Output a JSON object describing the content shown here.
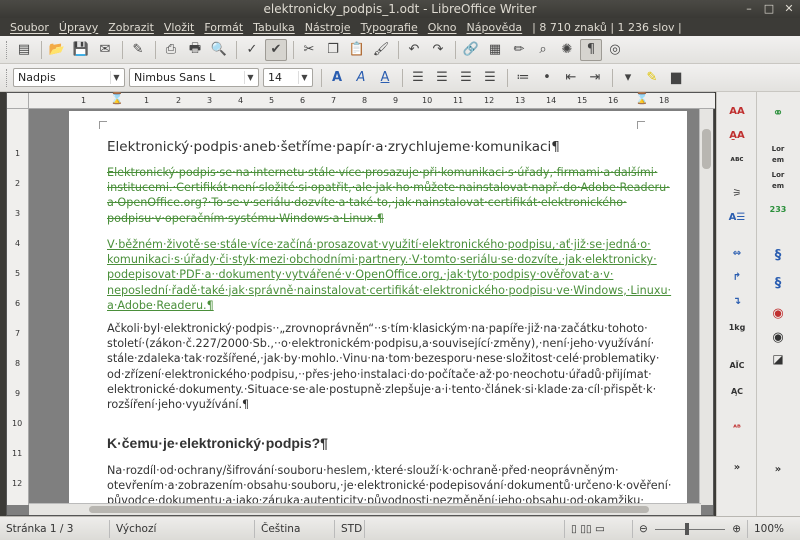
{
  "window": {
    "title": "elektronicky_podpis_1.odt - LibreOffice Writer",
    "minimize": "–",
    "maximize": "□",
    "close": "✕"
  },
  "menu": {
    "items": [
      "Soubor",
      "Úpravy",
      "Zobrazit",
      "Vložit",
      "Formát",
      "Tabulka",
      "Nástroje",
      "Typografie",
      "Okno",
      "Nápověda"
    ],
    "word_stats": "| 8 710 znaků | 1 236 slov |"
  },
  "toolbar2": {
    "paragraph_style": "Nadpis",
    "font_name": "Nimbus Sans L",
    "font_size": "14"
  },
  "ruler": {
    "numbers": [
      "1",
      "1",
      "2",
      "3",
      "4",
      "5",
      "6",
      "7",
      "8",
      "9",
      "10",
      "11",
      "12",
      "13",
      "14",
      "15",
      "16",
      "17",
      "18"
    ],
    "vnumbers": [
      "1",
      "2",
      "3",
      "4",
      "5",
      "6",
      "7",
      "8",
      "9",
      "10",
      "11",
      "12",
      "13"
    ]
  },
  "document": {
    "heading1": "Elektronický·podpis·aneb·šetříme·papír·a·zrychlujeme·komunikaci¶",
    "deleted_para": [
      "Elektronický·podpis·se·na·internetu·stále·více·prosazuje·při·komunikaci·s·úřady,·firmami·a·dalšími·",
      "institucemi.·Certifikát·není·složité·si·opatřit,·ale·jak·ho·můžete·nainstalovat·např.·do·Adobe·Readeru·",
      "a·OpenOffice.org?·To·se·v·seriálu·dozvíte·a·také·to,·jak·nainstalovat·certifikát·elektronického·",
      "podpisu·v·operačním·systému·Windows·a·Linux.¶"
    ],
    "inserted_para": [
      "V·běžném·životě·se·stále·více·začíná·prosazovat·využití·elektronického·podpisu,·ať·již·se·jedná·o·",
      "komunikaci·s·úřady·či·styk·mezi·obchodními·partnery.·V·tomto·seriálu·se·dozvíte,·jak·elektronicky·",
      "podepisovat·PDF·a··dokumenty·vytvářené·v·OpenOffice.org,·jak·tyto·podpisy·ověřovat·a·v·",
      "neposlední·řadě·také·jak·správně·nainstalovat·certifikát·elektronického·podpisu·ve·Windows,·Linuxu·",
      "a·Adobe·Readeru.¶"
    ],
    "normal_para": [
      "Ačkoli·byl·elektronický·podpis··„zrovnoprávněn“··s·tím·klasickým·na·papíře·již·na·začátku·tohoto·",
      "století·(zákon·č.227/2000·Sb.,··o·elektronickém·podpisu,a·související·změny),·není·jeho·využívání·",
      "stále·zdaleka·tak·rozšířené,·jak·by·mohlo.·Vinu·na·tom·bezesporu·nese·složitost·celé·problematiky·",
      "od·zřízení·elektronického·podpisu,··přes·jeho·instalaci·do·počítače·až·po·neochotu·úřadů·přijímat·",
      "elektronické·dokumenty.·Situace·se·ale·postupně·zlepšuje·a·i·tento·článek·si·klade·za·cíl·přispět·k·",
      "rozšíření·jeho·využívání.¶"
    ],
    "heading2": "K·čemu·je·elektronický·podpis?¶",
    "last_para": [
      "Na·rozdíl·od·ochrany/šifrování·souboru·heslem,·které·slouží·k·ochraně·před·neoprávněným·",
      "otevřením·a·zobrazením·obsahu·souboru,·je·elektronické·podepisování·dokumentů·určeno·k·ověření·",
      "původce·dokumentu·a·jako·záruka·autenticity·původnosti·nezměnění·jeho·obsahu·od·okamžiku·"
    ]
  },
  "status": {
    "page": "Stránka 1 / 3",
    "style": "Výchozí",
    "language": "Čeština",
    "mode": "STD",
    "zoom": "100%"
  }
}
